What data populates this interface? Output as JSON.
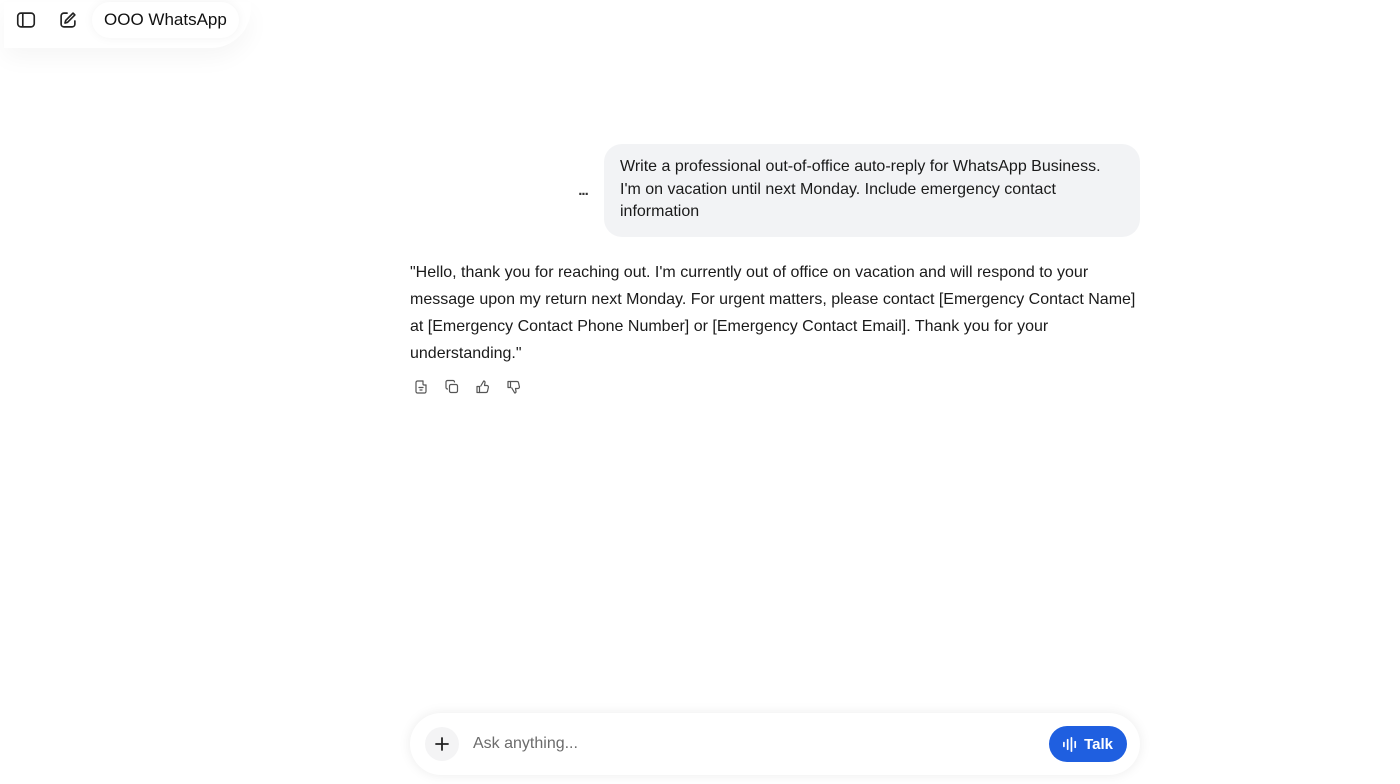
{
  "header": {
    "sidebar_toggle_icon": "sidebar-icon",
    "new_chat_icon": "edit-icon",
    "chat_title": "OOO WhatsApp"
  },
  "conversation": {
    "user_message": "Write a professional out-of-office auto-reply for WhatsApp Business. I'm on vacation until next Monday. Include emergency contact information",
    "user_more_label": "...",
    "assistant_message": "\"Hello, thank you for reaching out. I'm currently out of office on vacation and will respond to your message upon my return next Monday. For urgent matters, please contact [Emergency Contact Name] at [Emergency Contact Phone Number] or [Emergency Contact Email]. Thank you for your understanding.\"",
    "actions": [
      "read-aloud-icon",
      "copy-icon",
      "thumbs-up-icon",
      "thumbs-down-icon"
    ]
  },
  "composer": {
    "placeholder": "Ask anything...",
    "talk_label": "Talk"
  },
  "colors": {
    "accent": "#1f5fe0",
    "bubble": "#f2f3f5"
  }
}
